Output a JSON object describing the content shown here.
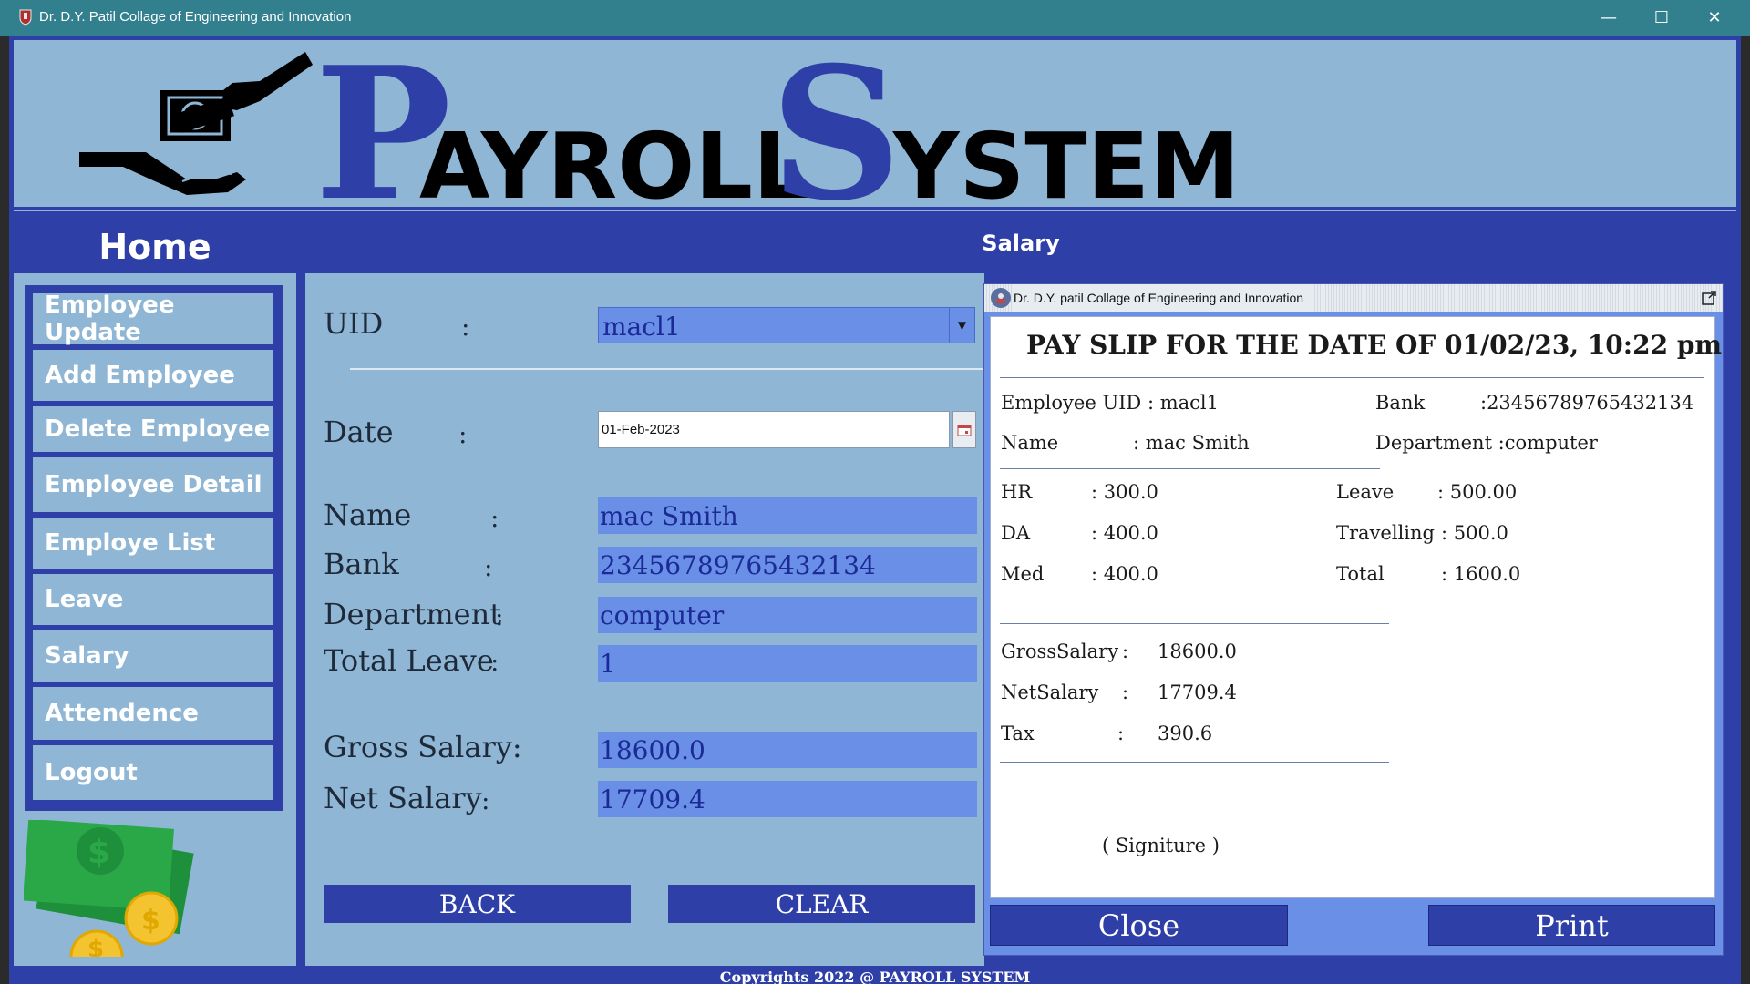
{
  "window": {
    "title": "Dr. D.Y. Patil Collage of Engineering and Innovation",
    "minimize_glyph": "—",
    "maximize_glyph": "☐",
    "close_glyph": "✕"
  },
  "banner": {
    "title_first": "P",
    "title_rest1": "AYROLL",
    "title_second": "S",
    "title_rest2": "YSTEM",
    "logo_icon": "hand-giving-money-icon"
  },
  "sidebar": {
    "heading": "Home",
    "items": [
      {
        "label": "Employee Update"
      },
      {
        "label": "Add Employee"
      },
      {
        "label": "Delete Employee"
      },
      {
        "label": "Employee Detail"
      },
      {
        "label": "Employe List"
      },
      {
        "label": "Leave"
      },
      {
        "label": "Salary"
      },
      {
        "label": "Attendence"
      },
      {
        "label": "Logout"
      }
    ],
    "art_icon": "money-coins-icon"
  },
  "main": {
    "heading": "Salary"
  },
  "form": {
    "uid_label": "UID",
    "uid_value": "macl1",
    "date_label": "Date",
    "date_value": "01-Feb-2023",
    "name_label": "Name",
    "name_value": "mac Smith",
    "bank_label": "Bank",
    "bank_value": "23456789765432134",
    "dept_label": "Department",
    "dept_value": "computer",
    "leave_label": "Total Leave",
    "leave_value": "1",
    "gross_label": "Gross Salary:",
    "gross_value": "18600.0",
    "net_label": "Net Salary",
    "net_value": "17709.4",
    "colon": ":",
    "back_label": "BACK",
    "clear_label": "CLEAR"
  },
  "payslip": {
    "dialog_title": "Dr. D.Y. patil Collage of Engineering and Innovation",
    "heading": "PAY SLIP FOR THE DATE OF 01/02/23, 10:22 pm",
    "uid_line": "Employee UID : macl1",
    "bank_label": "Bank",
    "bank_value": ":23456789765432134",
    "name_label": "Name",
    "name_value": ": mac Smith",
    "dept_line": "Department :computer",
    "hr_label": "HR",
    "hr_value": ":  300.0",
    "da_label": "DA",
    "da_value": ":  400.0",
    "med_label": "Med",
    "med_value": ":  400.0",
    "leave_label": "Leave",
    "leave_value": ":  500.00",
    "travel_label": "Travelling",
    "travel_value": ":  500.0",
    "total_label": "Total",
    "total_value": ":  1600.0",
    "gross_label": "GrossSalary",
    "gross_value": "18600.0",
    "net_label": "NetSalary",
    "net_value": "17709.4",
    "tax_label": "Tax",
    "tax_value": "390.6",
    "colon": ":",
    "signature": "( Signiture )",
    "close_label": "Close",
    "print_label": "Print"
  },
  "footer": {
    "text": "Copyrights 2022 @ PAYROLL SYSTEM"
  },
  "colors": {
    "primary_blue": "#2e3fa8",
    "panel_blue": "#8fb6d4",
    "field_blue": "#6a8fe6",
    "titlebar": "#327f8e"
  }
}
